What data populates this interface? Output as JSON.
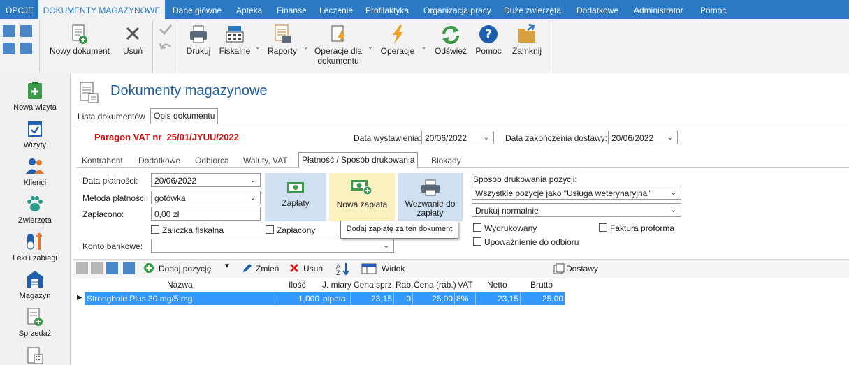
{
  "menu": {
    "items": [
      "OPCJE",
      "DOKUMENTY MAGAZYNOWE",
      "Dane główne",
      "Apteka",
      "Finanse",
      "Leczenie",
      "Profilaktyka",
      "Organizacja pracy",
      "Duże zwierzęta",
      "Dodatkowe",
      "Administrator",
      "Pomoc"
    ],
    "active": "DOKUMENTY MAGAZYNOWE"
  },
  "ribbon": {
    "new_document": "Nowy dokument",
    "delete": "Usuń",
    "print": "Drukuj",
    "fiscal": "Fiskalne",
    "reports": "Raporty",
    "doc_operations_1": "Operacje dla",
    "doc_operations_2": "dokumentu",
    "operations": "Operacje",
    "refresh": "Odśwież",
    "help": "Pomoc",
    "close": "Zamknij"
  },
  "sidebar": {
    "items": [
      "Nowa wizyta",
      "Wizyty",
      "Klienci",
      "Zwierzęta",
      "Leki i zabiegi",
      "Magazyn",
      "Sprzedaż"
    ]
  },
  "page": {
    "title": "Dokumenty magazynowe",
    "tabs": [
      "Lista dokumentów",
      "Opis dokumentu"
    ],
    "doc_number": "Paragon VAT nr  25/01/JYUU/2022",
    "issue_date_label": "Data wystawienia:",
    "issue_date": "20/06/2022",
    "delivery_date_label": "Data zakończenia dostawy:",
    "delivery_date": "20/06/2022",
    "subtabs": [
      "Kontrahent",
      "Dodatkowe",
      "Odbiorca",
      "Waluty, VAT",
      "Płatność / Sposób drukowania",
      "Blokady"
    ]
  },
  "payment": {
    "date_label": "Data płatności:",
    "date": "20/06/2022",
    "method_label": "Metoda płatności:",
    "method": "gotówka",
    "paid_label": "Zapłacono:",
    "paid": "0,00 zł",
    "fiscal_advance": "Zaliczka fiskalna",
    "paid_check": "Zapłacony",
    "bank_label": "Konto bankowe:",
    "bank": "",
    "btn_payments": "Zapłaty",
    "btn_new_payment": "Nowa zapłata",
    "btn_request_1": "Wezwanie do",
    "btn_request_2": "zapłaty",
    "tooltip": "Dodaj zapłatę za ten dokument"
  },
  "printing": {
    "label": "Sposób drukowania pozycji:",
    "mode": "Wszystkie pozycje jako \"Usługa weterynaryjna\"",
    "print_mode": "Drukuj normalnie",
    "printed": "Wydrukowany",
    "proforma": "Faktura proforma",
    "authorization": "Upoważnienie do odbioru"
  },
  "grid_toolbar": {
    "add": "Dodaj pozycję",
    "edit": "Zmień",
    "delete": "Usuń",
    "view": "Widok",
    "deliveries": "Dostawy"
  },
  "grid": {
    "headers": [
      "Nazwa",
      "Ilość",
      "J. miary",
      "Cena sprz.",
      "Rab.",
      "Cena (rab.)",
      "VAT",
      "Netto",
      "Brutto"
    ],
    "row": [
      "Stronghold Plus 30 mg/5 mg",
      "1,000",
      "pipeta",
      "23,15",
      "0",
      "25,00",
      "8%",
      "23,15",
      "25,00"
    ]
  }
}
